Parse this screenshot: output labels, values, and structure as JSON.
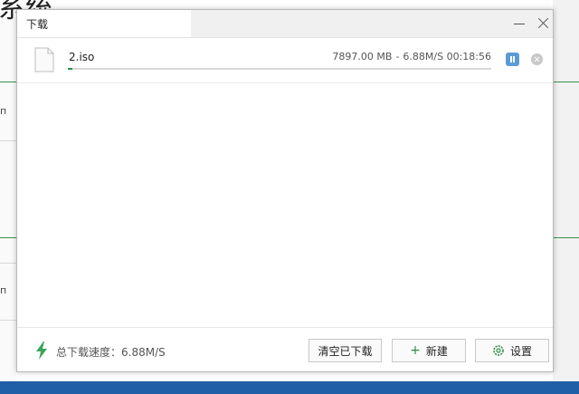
{
  "background": {
    "title_fragment": "系统",
    "left_char": "п"
  },
  "dialog": {
    "title": "下载",
    "minimize_icon": "minimize-icon",
    "close_icon": "close-icon"
  },
  "download": {
    "file_name": "2.iso",
    "file_icon": "file-icon",
    "size": "7897.00 MB",
    "separator": "-",
    "speed": "6.88M/S",
    "time_remaining": "00:18:56",
    "progress": 0.01,
    "pause_icon": "pause-icon",
    "remove_icon": "remove-icon"
  },
  "footer": {
    "total_speed_label": "总下载速度：6.88M/S",
    "clear_label": "清空已下载",
    "new_label": "新建",
    "settings_label": "设置"
  },
  "colors": {
    "accent": "#2f8f46",
    "pause_button": "#5b9bd5",
    "taskbar": "#1f5fa8"
  }
}
